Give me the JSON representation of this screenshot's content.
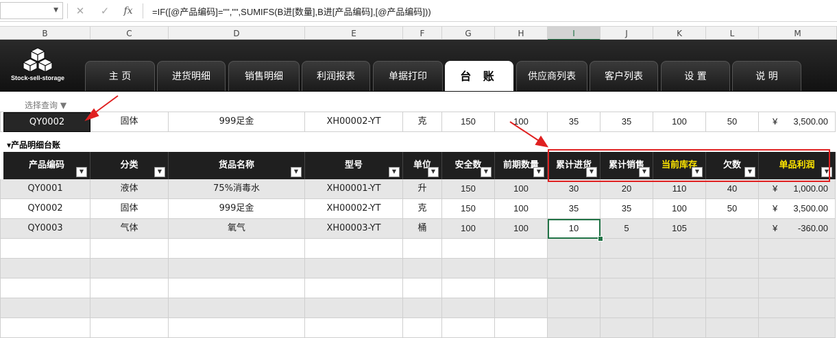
{
  "formula_bar": {
    "name_box": "",
    "cancel_icon": "✕",
    "enter_icon": "✓",
    "fx_label": "fx",
    "formula": "=IF([@产品编码]=\"\",\"\",SUMIFS(B进[数量],B进[产品编码],[@产品编码]))"
  },
  "columns": [
    "B",
    "C",
    "D",
    "E",
    "F",
    "G",
    "H",
    "I",
    "J",
    "K",
    "L",
    "M"
  ],
  "selected_column": "I",
  "logo_text": "Stock-sell-storage",
  "tabs": [
    "主 页",
    "进货明细",
    "销售明细",
    "利润报表",
    "单据打印",
    "台 账",
    "供应商列表",
    "客户列表",
    "设 置",
    "说 明"
  ],
  "active_tab": "台 账",
  "query": {
    "label": "选择查询 ▼",
    "row": [
      "QY0002",
      "固体",
      "999足金",
      "XH00002-YT",
      "克",
      "150",
      "100",
      "35",
      "35",
      "100",
      "50"
    ],
    "profit_currency": "¥",
    "profit_value": "3,500.00"
  },
  "section_title": "▾产品明细台账",
  "table": {
    "headers": [
      "产品编码",
      "分类",
      "货品名称",
      "型号",
      "单位",
      "安全数",
      "前期数量",
      "累计进货",
      "累计销售",
      "当前库存",
      "欠数",
      "单品利润"
    ],
    "rows": [
      [
        "QY0001",
        "液体",
        "75%消毒水",
        "XH00001-YT",
        "升",
        "150",
        "100",
        "30",
        "20",
        "110",
        "40",
        "¥",
        "1,000.00"
      ],
      [
        "QY0002",
        "固体",
        "999足金",
        "XH00002-YT",
        "克",
        "150",
        "100",
        "35",
        "35",
        "100",
        "50",
        "¥",
        "3,500.00"
      ],
      [
        "QY0003",
        "气体",
        "氧气",
        "XH00003-YT",
        "桶",
        "100",
        "100",
        "10",
        "5",
        "105",
        "",
        "¥",
        "-360.00"
      ]
    ]
  },
  "colors": {
    "dark": "#1f1f1f",
    "highlight_text": "#ffe600",
    "annotation": "#e02020",
    "excel_green": "#217346"
  }
}
